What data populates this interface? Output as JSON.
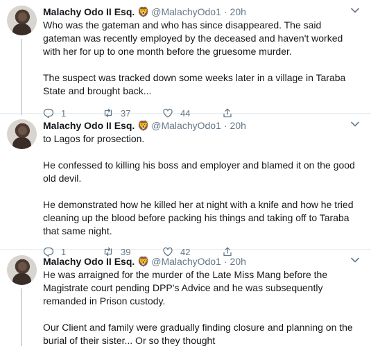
{
  "tweets": [
    {
      "name": "Malachy Odo II Esq.",
      "badge": "🦁",
      "handle": "@MalachyOdo1",
      "time": "20h",
      "paragraphs": [
        "Who was the gateman and who has since disappeared. The said gateman was recently employed by the deceased and haven't worked with her for up to one month before the gruesome murder.",
        "The suspect was tracked down some weeks later in a village in Taraba State and brought back..."
      ],
      "replies": "1",
      "retweets": "37",
      "likes": "44"
    },
    {
      "name": "Malachy Odo II Esq.",
      "badge": "🦁",
      "handle": "@MalachyOdo1",
      "time": "20h",
      "paragraphs": [
        "to Lagos for prosection.",
        "He confessed to killing his boss and employer and blamed it on the good old devil.",
        "He demonstrated how he killed her at night with a knife and how he tried cleaning up the blood before packing his things and taking off to Taraba that same night."
      ],
      "replies": "1",
      "retweets": "39",
      "likes": "42"
    },
    {
      "name": "Malachy Odo II Esq.",
      "badge": "🦁",
      "handle": "@MalachyOdo1",
      "time": "20h",
      "paragraphs": [
        "He was arraigned for the murder of the Late Miss Mang before the Magistrate court pending DPP's Advice and he was subsequently remanded in Prison custody.",
        "Our Client and family were gradually finding closure and planning on the burial of their sister... Or so they thought"
      ]
    }
  ]
}
